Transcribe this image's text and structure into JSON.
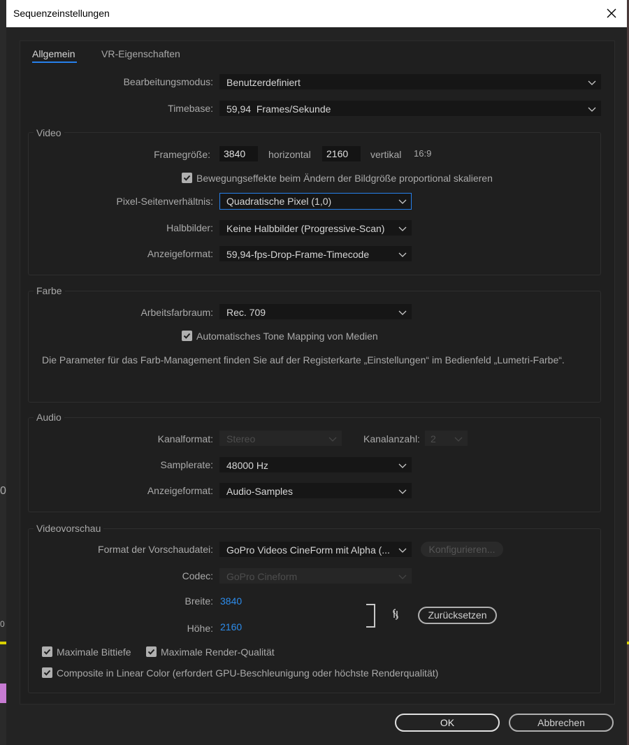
{
  "window": {
    "title": "Sequenzeinstellungen"
  },
  "tabs": [
    {
      "label": "Allgemein",
      "active": true
    },
    {
      "label": "VR-Eigenschaften",
      "active": false
    }
  ],
  "general": {
    "edit_mode_label": "Bearbeitungsmodus:",
    "edit_mode_value": "Benutzerdefiniert",
    "timebase_label": "Timebase:",
    "timebase_value": "59,94  Frames/Sekunde"
  },
  "video": {
    "section_title": "Video",
    "frame_size_label": "Framegröße:",
    "width_value": "3840",
    "horizontal_label": "horizontal",
    "height_value": "2160",
    "vertical_label": "vertikal",
    "aspect_ratio": "16:9",
    "scale_checkbox_label": "Bewegungseffekte beim Ändern der Bildgröße proportional skalieren",
    "scale_checked": true,
    "pixel_aspect_label": "Pixel-Seitenverhältnis:",
    "pixel_aspect_value": "Quadratische Pixel (1,0)",
    "fields_label": "Halbbilder:",
    "fields_value": "Keine Halbbilder (Progressive-Scan)",
    "display_format_label": "Anzeigeformat:",
    "display_format_value": "59,94-fps-Drop-Frame-Timecode"
  },
  "color": {
    "section_title": "Farbe",
    "working_space_label": "Arbeitsfarbraum:",
    "working_space_value": "Rec. 709",
    "tone_mapping_label": "Automatisches Tone Mapping von Medien",
    "tone_mapping_checked": true,
    "info_text": "Die Parameter für das Farb-Management finden Sie auf der Registerkarte „Einstellungen“ im Bedienfeld „Lumetri-Farbe“."
  },
  "audio": {
    "section_title": "Audio",
    "channel_format_label": "Kanalformat:",
    "channel_format_value": "Stereo",
    "channel_count_label": "Kanalanzahl:",
    "channel_count_value": "2",
    "sample_rate_label": "Samplerate:",
    "sample_rate_value": "48000 Hz",
    "display_format_label": "Anzeigeformat:",
    "display_format_value": "Audio-Samples"
  },
  "preview": {
    "section_title": "Videovorschau",
    "file_format_label": "Format der Vorschaudatei:",
    "file_format_value": "GoPro Videos CineForm mit Alpha (...",
    "configure_label": "Konfigurieren...",
    "codec_label": "Codec:",
    "codec_value": "GoPro Cineform",
    "width_label": "Breite:",
    "width_value": "3840",
    "height_label": "Höhe:",
    "height_value": "2160",
    "reset_label": "Zurücksetzen",
    "max_bit_depth_label": "Maximale Bittiefe",
    "max_bit_depth_checked": true,
    "max_render_label": "Maximale Render-Qualität",
    "max_render_checked": true,
    "linear_color_label": "Composite in Linear Color (erfordert GPU-Beschleunigung oder höchste Renderqualität)",
    "linear_color_checked": true
  },
  "buttons": {
    "ok": "OK",
    "cancel": "Abbrechen"
  },
  "background": {
    "left_digit_1": "0",
    "left_digit_2": "0"
  },
  "colors": {
    "accent": "#2680eb",
    "link": "#2d8ceb",
    "panel": "#1f1f1f",
    "dialog": "#232323"
  }
}
